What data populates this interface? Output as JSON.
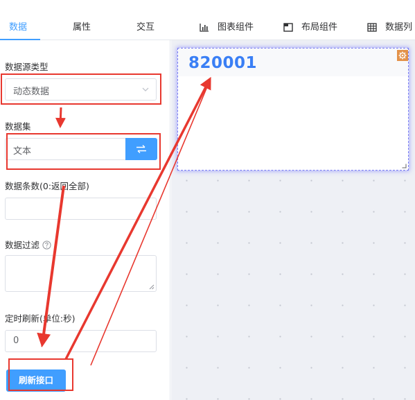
{
  "tabs": [
    {
      "label": "数据",
      "active": true
    },
    {
      "label": "属性",
      "active": false
    },
    {
      "label": "交互",
      "active": false
    }
  ],
  "components": [
    {
      "label": "图表组件",
      "icon": "bar-chart-icon"
    },
    {
      "label": "布局组件",
      "icon": "layout-icon"
    },
    {
      "label": "数据列",
      "icon": "table-grid-icon"
    }
  ],
  "form": {
    "source_type_label": "数据源类型",
    "source_type_value": "动态数据",
    "dataset_label": "数据集",
    "dataset_value": "文本",
    "count_label": "数据条数(0:返回全部)",
    "count_value": "",
    "filter_label": "数据过滤",
    "filter_value": "",
    "timer_label": "定时刷新(单位:秒)",
    "timer_value": "0",
    "refresh_button": "刷新接口"
  },
  "widget": {
    "value": "820001"
  },
  "colors": {
    "accent": "#409eff",
    "number": "#3a7ff5",
    "annotation": "#e8382f",
    "canvas_bg": "#eef0f5"
  }
}
